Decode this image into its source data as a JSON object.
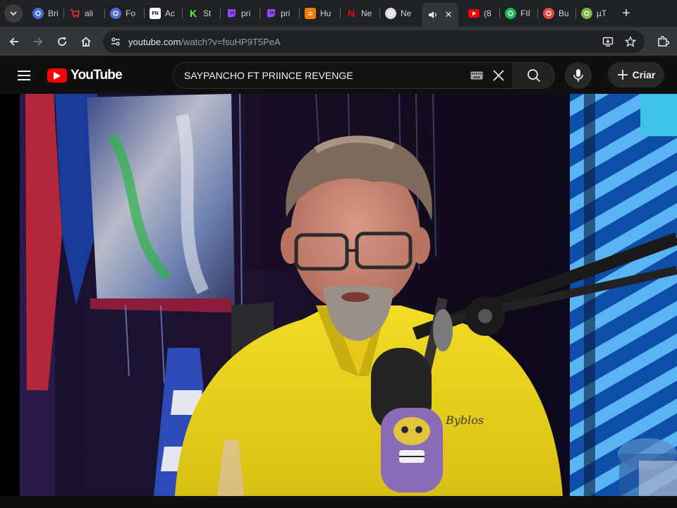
{
  "browser": {
    "tabs": [
      {
        "label": "Bri",
        "favicon": "globe-icon",
        "color": "#4a6cd4"
      },
      {
        "label": "ali",
        "favicon": "cart-icon",
        "color": "#e43225"
      },
      {
        "label": "Fo",
        "favicon": "globe-icon",
        "color": "#4a6cd4"
      },
      {
        "label": "Ac",
        "favicon": "fn-icon",
        "glyph": "FN",
        "color": "#ffffff"
      },
      {
        "label": "St",
        "favicon": "kick-icon",
        "glyph": "K",
        "color": "#53fc18"
      },
      {
        "label": "pri",
        "favicon": "twitch-icon",
        "color": "#9146ff"
      },
      {
        "label": "pri",
        "favicon": "twitch-icon",
        "color": "#9146ff"
      },
      {
        "label": "Hu",
        "favicon": "blogger-icon",
        "color": "#f57d00"
      },
      {
        "label": "Ne",
        "favicon": "netflix-icon",
        "glyph": "N",
        "color": "#e50914"
      },
      {
        "label": "Ne",
        "favicon": "chrome-icon",
        "color": "#dddddd"
      },
      {
        "label": "",
        "favicon": "speaker-icon",
        "active": true
      },
      {
        "label": "(8",
        "favicon": "youtube-icon",
        "color": "#ff0000"
      },
      {
        "label": "FII",
        "favicon": "green-circle-icon",
        "color": "#1db954"
      },
      {
        "label": "Bu",
        "favicon": "colorwheel-icon",
        "color": "#e74c3c"
      },
      {
        "label": "µT",
        "favicon": "utorrent-icon",
        "color": "#76b83f"
      }
    ],
    "url_host": "youtube.com",
    "url_path": "/watch?v=fsuHP9T5PeA"
  },
  "youtube": {
    "logo_text": "YouTube",
    "search_query": "SAYPANCHO FT PRIINCE REVENGE",
    "create_label": "Criar"
  },
  "video": {
    "description": "Podcast scene: man with glasses and grey beard in yellow polo shirt reading, microphone with skull-face cover branded Byblos, colorful neon-lit studio background"
  },
  "mic_branding": "Byblos"
}
